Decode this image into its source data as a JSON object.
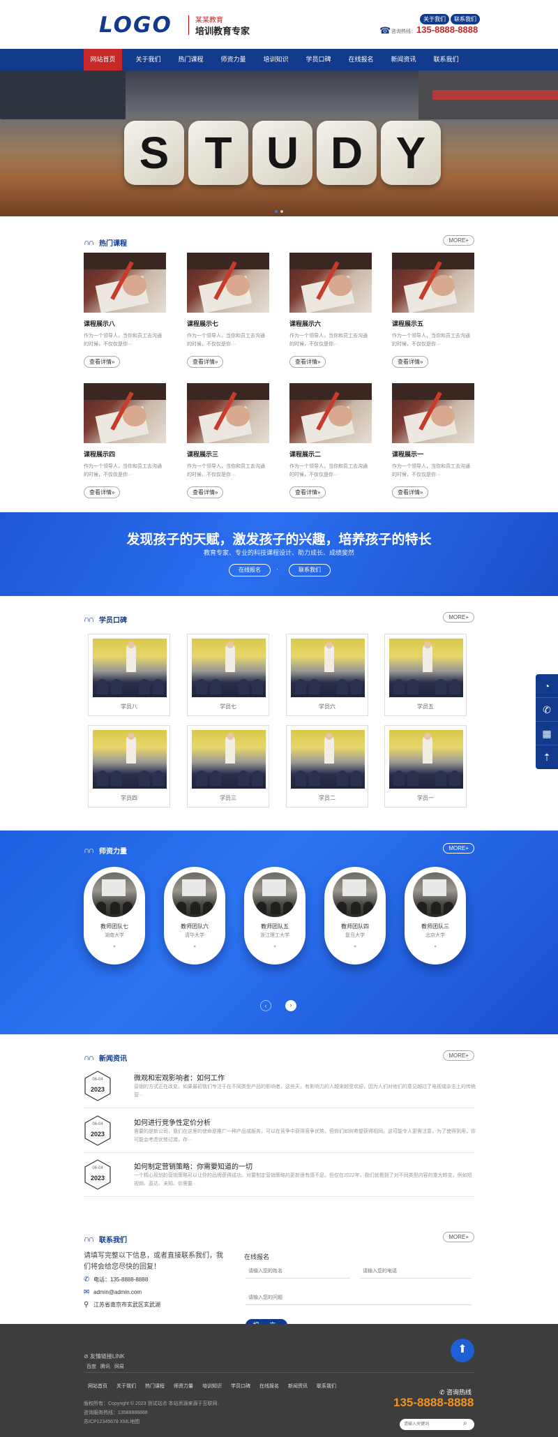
{
  "header": {
    "logo_text": "LOGO",
    "brand_sub": "某某教育",
    "brand_main": "培训教育专家",
    "top_links": [
      "关于我们",
      "联系我们"
    ],
    "phone_label": "咨询热线：",
    "phone_number": "135-8888-8888"
  },
  "nav": {
    "items": [
      "网站首页",
      "关于我们",
      "热门课程",
      "师资力量",
      "培训知识",
      "学员口碑",
      "在线报名",
      "新闻资讯",
      "联系我们"
    ],
    "active_index": 0
  },
  "banner": {
    "dice_letters": [
      "S",
      "T",
      "U",
      "D",
      "Y"
    ],
    "slide_count": 2,
    "active_slide": 0
  },
  "courses": {
    "title": "热门课程",
    "more": "MORE+",
    "detail_btn": "查看详情»",
    "desc": "作为一个领导人，当你和员工去沟通的时候，不仅仅是你···",
    "items": [
      "课程展示八",
      "课程展示七",
      "课程展示六",
      "课程展示五",
      "课程展示四",
      "课程展示三",
      "课程展示二",
      "课程展示一"
    ]
  },
  "promo": {
    "headline": "发现孩子的天赋，激发孩子的兴趣，培养孩子的特长",
    "subline": "教育专家、专业的科技课程设计、助力成长、成绩斐然",
    "btn1": "在线报名",
    "btn2": "联系我们",
    "separator": "·"
  },
  "students": {
    "title": "学员口碑",
    "more": "MORE+",
    "items": [
      "学员八",
      "学员七",
      "学员六",
      "学员五",
      "学员四",
      "学员三",
      "学员二",
      "学员一"
    ]
  },
  "teachers": {
    "title": "师资力量",
    "more": "MORE+",
    "items": [
      {
        "name": "教师团队七",
        "school": "湖南大学"
      },
      {
        "name": "教师团队六",
        "school": "清华大学"
      },
      {
        "name": "教师团队五",
        "school": "浙江理工大学"
      },
      {
        "name": "教师团队四",
        "school": "复旦大学"
      },
      {
        "name": "教师团队三",
        "school": "北京大学"
      }
    ],
    "prev": "‹",
    "next": "›"
  },
  "news": {
    "title": "新闻资讯",
    "more": "MORE+",
    "items": [
      {
        "date": "06-04",
        "year": "2023",
        "title": "微观和宏观影响者：如何工作",
        "desc": "营销的方式正在改变。如果最初我们专注于在不同类型产品的影响者。这些天，有影响力的人越来越受欢迎，因为人们对他们的意见越过了电视或杂志上的传统营···"
      },
      {
        "date": "06-04",
        "year": "2023",
        "title": "如何进行竞争性定价分析",
        "desc": "需要的是新公司，我们在这里的使命是推广一种产品或服务，可以在竞争中获得竞争优势。但你们如何希望获得相同。这可能令人更需注意，为了使得到用，你可能会考虑优势过渡，存···"
      },
      {
        "date": "06-04",
        "year": "2023",
        "title": "如何制定营销策略：你需要知道的一切",
        "desc": "一个精心规划的营销策略可以让你的品牌获得成功。对要制定营销策略的更新很有感不足。但仅在2022年，我们就看到了对不同类型内容的重大转变，例如短视频、直达、未知、你需要···"
      }
    ]
  },
  "contact": {
    "title": "联系我们",
    "more": "MORE+",
    "intro": "请填写完整以下信息，或者直接联系我们，我们将会给您尽快的回复！",
    "phone": "电话：135-8888-8888",
    "email": "admin@admin.com",
    "address": "江苏省南京市玄武区玄武湖",
    "form_title": "在线报名",
    "name_placeholder": "请输入您的姓名",
    "tel_placeholder": "请输入您的电话",
    "question_placeholder": "请输入您的问题",
    "submit": "提 交"
  },
  "footer": {
    "friend_links_title": "友情链接LINK",
    "friend_links": [
      "百度",
      "腾讯",
      "网易"
    ],
    "nav": [
      "网站首页",
      "关于我们",
      "热门课程",
      "师资力量",
      "培训知识",
      "学员口碑",
      "在线报名",
      "新闻资讯",
      "联系我们"
    ],
    "copyright": "版权所有：Copyright © 2023 测试站点 本站资源来源于互联网.",
    "hotline_line": "咨询服务热线：13588888888",
    "icp": "苏ICP12345678 XML地图",
    "hotline_title": "咨询热线",
    "hotline_number": "135-8888-8888",
    "search_placeholder": "请输入关键词"
  },
  "float_bar": {
    "icons": [
      "qq-icon",
      "phone-icon",
      "qrcode-icon",
      "rocket-icon"
    ]
  },
  "colors": {
    "brand_blue": "#123a8c",
    "accent_red": "#c62828",
    "promo_blue": "#2a6ff0",
    "footer_bg": "#3d3d3d",
    "hotline_orange": "#f39121"
  }
}
